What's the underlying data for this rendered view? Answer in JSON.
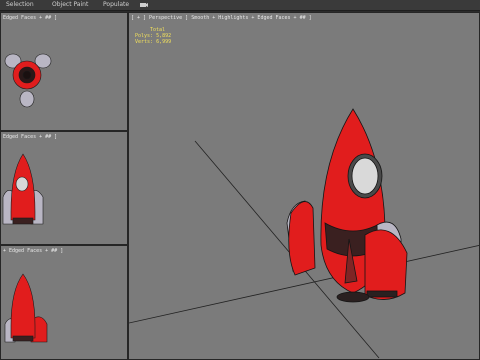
{
  "menubar": {
    "items": [
      "Selection",
      "Object Paint",
      "Populate"
    ],
    "extra_icon": "camera-icon"
  },
  "viewports": {
    "top": {
      "label": "Edged Faces + ## ]"
    },
    "front": {
      "label": "Edged Faces + ## ]"
    },
    "left": {
      "label": "+ Edged Faces + ## ]"
    },
    "perspective": {
      "label": "[ + ] Perspective ] Smooth + Highlights + Edged Faces + ## ]",
      "stats": {
        "total_label": "Total",
        "polys_label": "Polys:",
        "polys_value": "5,892",
        "verts_label": "Verts:",
        "verts_value": "6,999"
      }
    }
  },
  "colors": {
    "viewport_bg": "#7b7b7b",
    "rocket_red": "#e11d1d",
    "metal": "#b9b6c4",
    "dark": "#3a2020",
    "hud": "#f2e05c"
  }
}
